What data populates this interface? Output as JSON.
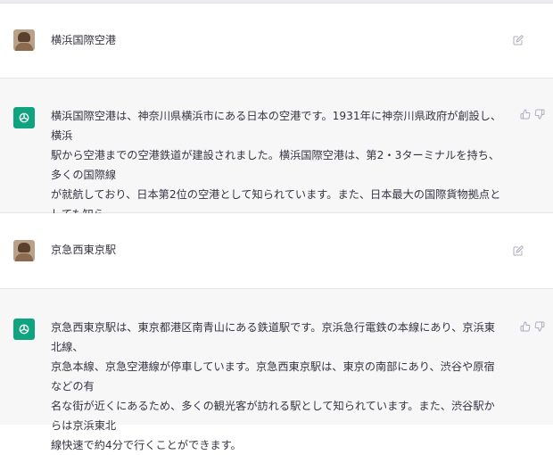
{
  "conversation": [
    {
      "role": "user",
      "text": "横浜国際空港"
    },
    {
      "role": "assistant",
      "text": "横浜国際空港は、神奈川県横浜市にある日本の空港です。1931年に神奈川県政府が創設し、横浜\n駅から空港までの空港鉄道が建設されました。横浜国際空港は、第2・3ターミナルを持ち、多くの国際線\nが就航しており、日本第2位の空港として知られています。また、日本最大の国際貨物拠点としても知ら\nれています。"
    },
    {
      "role": "user",
      "text": "京急西東京駅"
    },
    {
      "role": "assistant",
      "text": "京急西東京駅は、東京都港区南青山にある鉄道駅です。京浜急行電鉄の本線にあり、京浜東北線、\n京急本線、京急空港線が停車しています。京急西東京駅は、東京の南部にあり、渋谷や原宿などの有\n名な街が近くにあるため、多くの観光客が訪れる駅として知られています。また、渋谷駅からは京浜東北\n線快速で約4分で行くことができます。"
    }
  ],
  "colors": {
    "assistant_avatar": "#10a37f",
    "assistant_row_bg": "#f7f7f8",
    "icon_gray": "#acacbe"
  },
  "icons": {
    "edit": "edit-icon",
    "thumbs_up": "thumbs-up-icon",
    "thumbs_down": "thumbs-down-icon",
    "assistant": "openai-logo-icon"
  }
}
